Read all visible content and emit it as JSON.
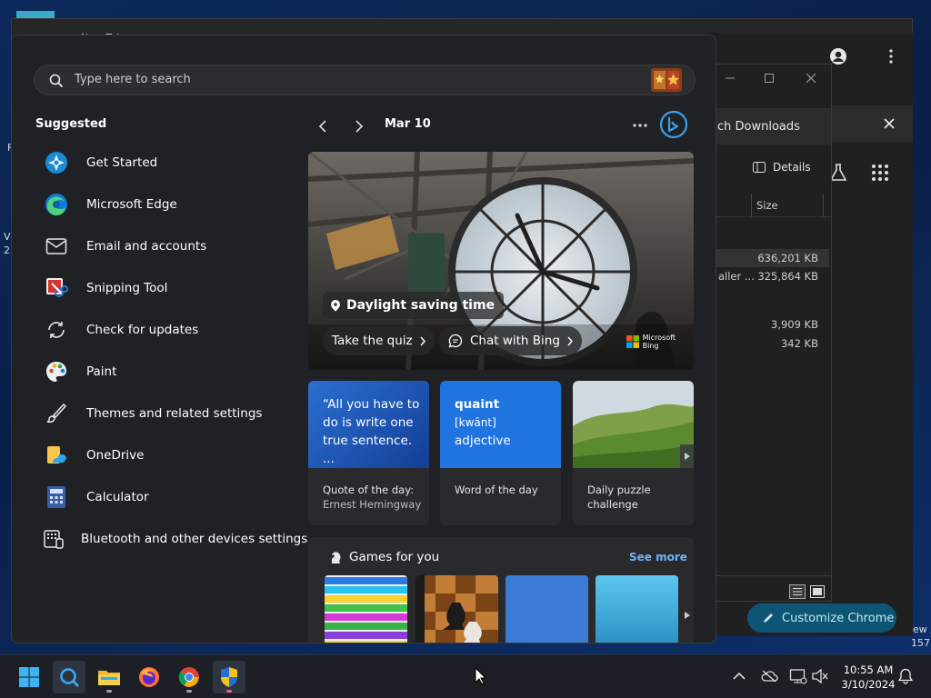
{
  "browser": {
    "tab_label": "New Tab",
    "download_search_text": "ch Downloads",
    "customize_button": "Customize Chrome"
  },
  "explorer": {
    "details_label": "Details",
    "column_size": "Size",
    "rows": [
      {
        "name": "",
        "size": "636,201 KB"
      },
      {
        "name": "aller ...",
        "size": "325,864 KB"
      },
      {
        "name": "",
        "size": "3,909 KB"
      },
      {
        "name": "",
        "size": "342 KB"
      }
    ]
  },
  "desktop_text": {
    "left_fragments": [
      "F",
      "V",
      "2"
    ],
    "right_fragments": [
      "ew",
      "157"
    ]
  },
  "start": {
    "search_placeholder": "Type here to search",
    "suggested_title": "Suggested",
    "apps": [
      {
        "label": "Get Started",
        "icon": "get-started-icon"
      },
      {
        "label": "Microsoft Edge",
        "icon": "edge-icon"
      },
      {
        "label": "Email and accounts",
        "icon": "mail-icon"
      },
      {
        "label": "Snipping Tool",
        "icon": "snipping-tool-icon"
      },
      {
        "label": "Check for updates",
        "icon": "refresh-icon"
      },
      {
        "label": "Paint",
        "icon": "paint-icon"
      },
      {
        "label": "Themes and related settings",
        "icon": "brush-icon"
      },
      {
        "label": "OneDrive",
        "icon": "onedrive-icon"
      },
      {
        "label": "Calculator",
        "icon": "calculator-icon"
      },
      {
        "label": "Bluetooth and other devices settings",
        "icon": "devices-icon"
      }
    ]
  },
  "widgets": {
    "date": "Mar 10",
    "hero": {
      "title": "Daylight saving time",
      "quiz_button": "Take the quiz",
      "chat_button": "Chat with Bing",
      "bing_logo_line1": "Microsoft",
      "bing_logo_line2": "Bing"
    },
    "cards": [
      {
        "top": "“All you have to do is write one true sentence. ...",
        "foot1": "Quote of the day:",
        "foot2": "Ernest Hemingway"
      },
      {
        "word": "quaint",
        "pron": "[kwānt]",
        "pos": "adjective",
        "foot1": "Word of the day",
        "foot2": ""
      },
      {
        "foot1": "Daily puzzle",
        "foot2": "challenge"
      }
    ],
    "games": {
      "title": "Games for you",
      "see_more": "See more"
    }
  },
  "taskbar": {
    "time": "10:55 AM",
    "date": "3/10/2024"
  },
  "colors": {
    "accent_blue": "#1a73e8",
    "word_card": "#1f6fd6",
    "quote_card": "#1c5bc2",
    "chrome_customize": "#0e5575"
  }
}
